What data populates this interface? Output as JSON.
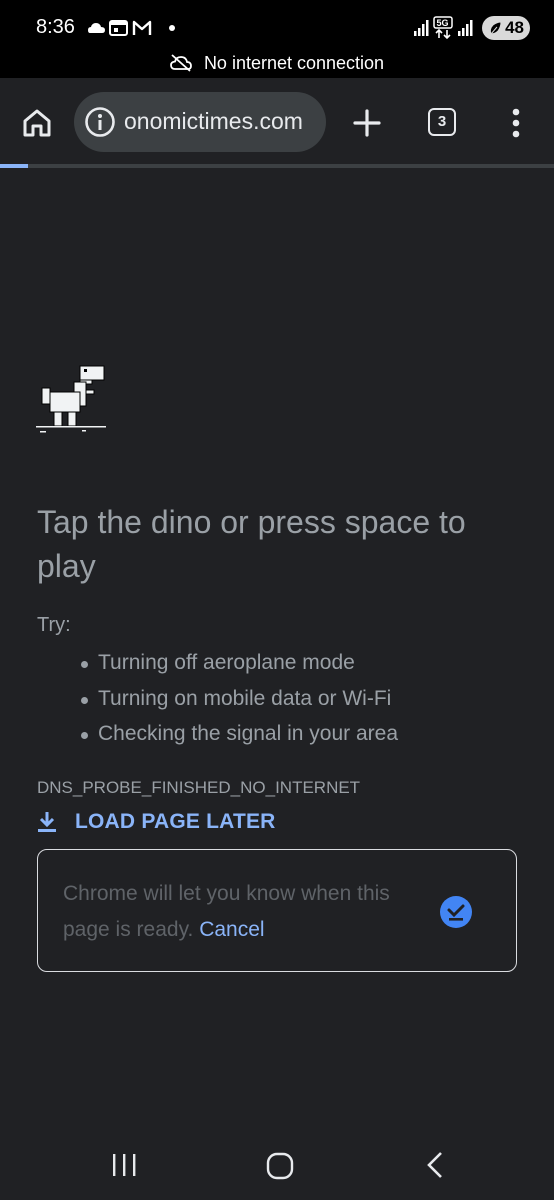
{
  "status_bar": {
    "time": "8:36",
    "network_label": "5G",
    "battery": "48",
    "icons": [
      "cloud-icon",
      "calendar-icon",
      "gmail-icon",
      "notification-dot-icon",
      "signal-icon",
      "data-arrows-icon",
      "signal-icon",
      "battery-icon"
    ]
  },
  "offline_banner": {
    "text": "No internet connection",
    "icon": "cloud-off-icon"
  },
  "toolbar": {
    "url": "onomictimes.com",
    "tab_count": "3",
    "icons": [
      "home-icon",
      "info-icon",
      "plus-icon",
      "tab-switcher-icon",
      "more-vert-icon"
    ],
    "load_progress": 0.05
  },
  "error_page": {
    "headline": "Tap the dino or press space to play",
    "try_label": "Try:",
    "suggestions": [
      "Turning off aeroplane mode",
      "Turning on mobile data or Wi-Fi",
      "Checking the signal in your area"
    ],
    "error_code": "DNS_PROBE_FINISHED_NO_INTERNET",
    "load_later_label": "LOAD PAGE LATER",
    "snackbar_text": "Chrome will let you know when this page is ready.",
    "snackbar_cancel": "Cancel"
  },
  "colors": {
    "background": "#202124",
    "accent": "#8ab4f8",
    "secondary_text": "#9aa0a6"
  }
}
